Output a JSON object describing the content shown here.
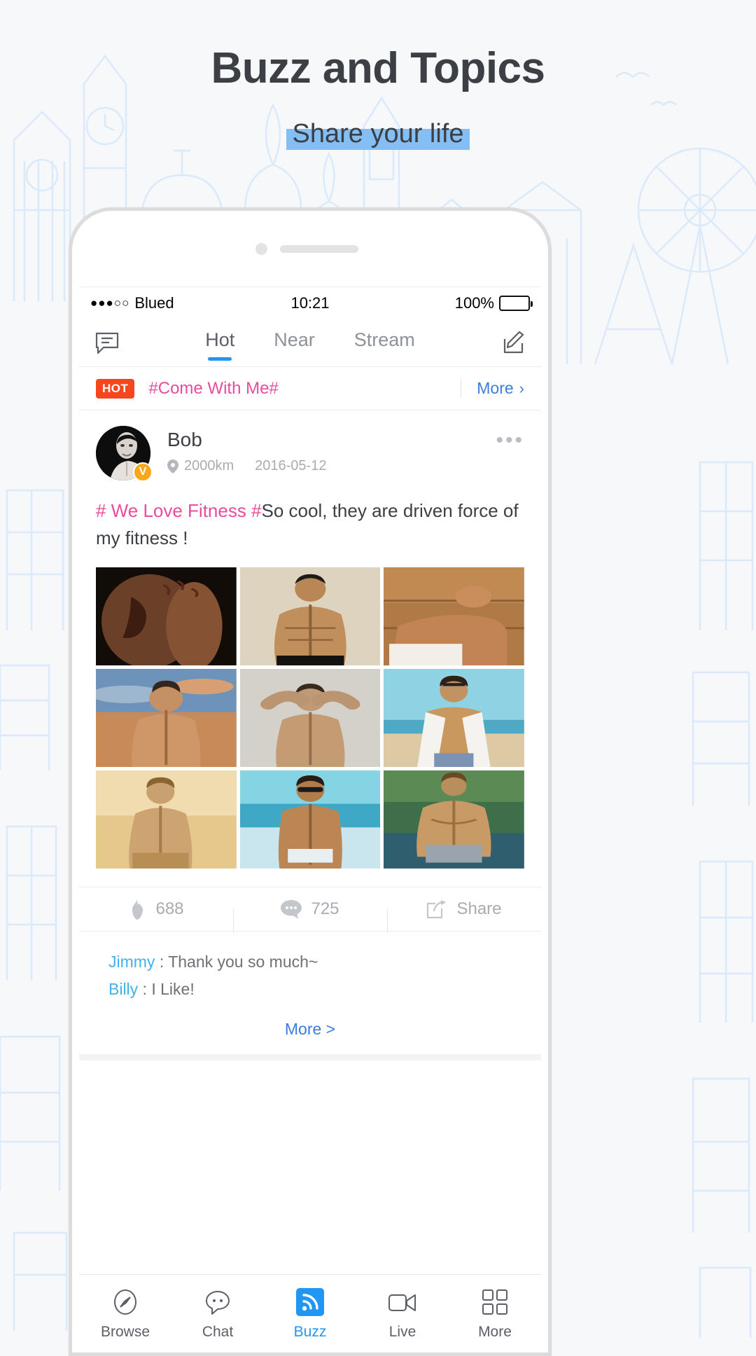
{
  "hero": {
    "title": "Buzz and Topics",
    "subtitle": "Share your life",
    "highlight_color": "#83bef5",
    "title_color": "#3c3f43"
  },
  "statusbar": {
    "signal_dots": "●●●○○",
    "carrier": "Blued",
    "time": "10:21",
    "battery_percent": "100%"
  },
  "navbar": {
    "left_icon": "message-bubble-icon",
    "right_icon": "compose-icon",
    "tabs": [
      {
        "label": "Hot",
        "active": true
      },
      {
        "label": "Near",
        "active": false
      },
      {
        "label": "Stream",
        "active": false
      }
    ],
    "active_underline_color": "#2196f3"
  },
  "hotbar": {
    "badge": "HOT",
    "badge_color": "#f5461e",
    "topic": "#Come With Me#",
    "topic_color": "#ea4c9b",
    "more_label": "More",
    "more_chevron": "›",
    "more_color": "#3b7ddd"
  },
  "post": {
    "user": "Bob",
    "verified_badge": "V",
    "distance": "2000km",
    "date": "2016-05-12",
    "more_dots": "•••",
    "hashtag": "# We Love Fitness #",
    "body": "So cool, they are driven force of my fitness !",
    "photo_count": 9,
    "photos": [
      {
        "name": "tattoo-torso-photo"
      },
      {
        "name": "beanie-physique-photo"
      },
      {
        "name": "sauna-recline-photo"
      },
      {
        "name": "sunset-sky-physique-photo"
      },
      {
        "name": "arms-behind-head-photo"
      },
      {
        "name": "open-shirt-beach-photo"
      },
      {
        "name": "golden-light-physique-photo"
      },
      {
        "name": "sunglasses-beach-photo"
      },
      {
        "name": "back-muscles-water-photo"
      }
    ],
    "actions": [
      {
        "icon": "flame-icon",
        "label": "688"
      },
      {
        "icon": "comment-icon",
        "label": "725"
      },
      {
        "icon": "share-icon",
        "label": "Share"
      }
    ],
    "comments": [
      {
        "name": "Jimmy",
        "separator": ":",
        "text": "Thank you so much~"
      },
      {
        "name": "Billy",
        "separator": ":",
        "text": "I Like!"
      }
    ],
    "comments_more": "More",
    "comments_more_chevron": ">",
    "comment_name_color": "#45b0ef"
  },
  "tabbar": {
    "items": [
      {
        "label": "Browse",
        "icon": "compass-icon",
        "active": false
      },
      {
        "label": "Chat",
        "icon": "chat-bubble-icon",
        "active": false
      },
      {
        "label": "Buzz",
        "icon": "rss-icon",
        "active": true
      },
      {
        "label": "Live",
        "icon": "video-camera-icon",
        "active": false
      },
      {
        "label": "More",
        "icon": "grid-icon",
        "active": false
      }
    ],
    "active_color": "#2196f3"
  }
}
